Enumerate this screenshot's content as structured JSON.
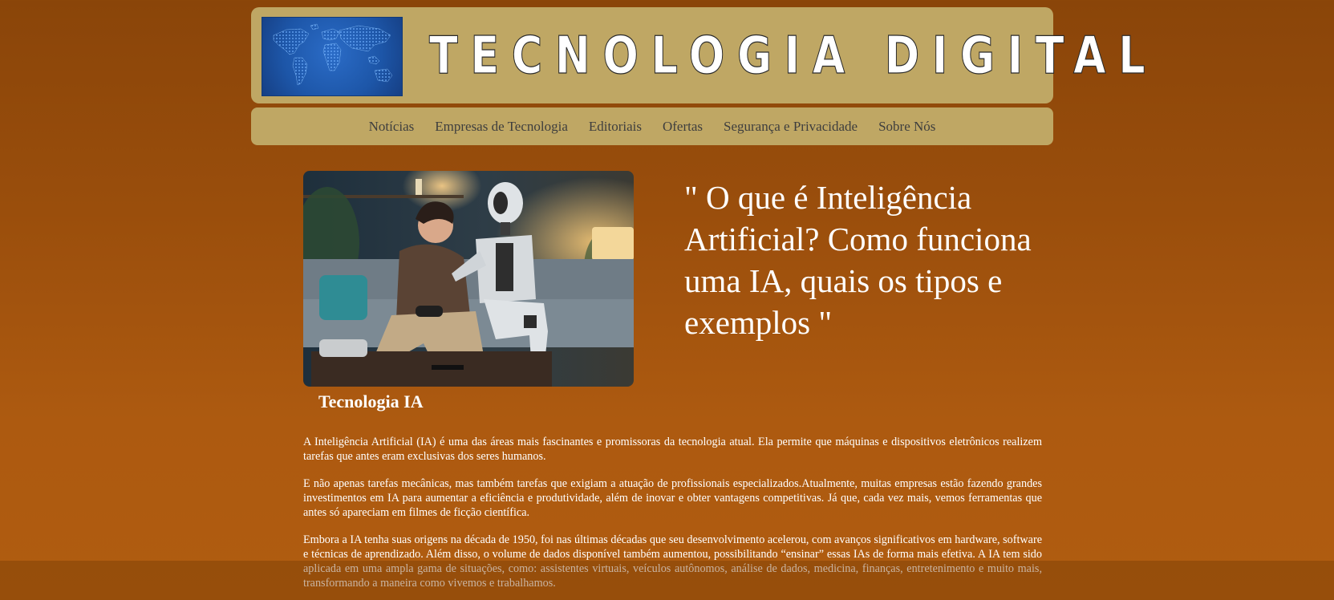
{
  "header": {
    "title": "TECNOLOGIA DIGITAL",
    "logo_icon": "world-map-icon"
  },
  "nav": {
    "items": [
      {
        "label": "Notícias"
      },
      {
        "label": "Empresas de Tecnologia"
      },
      {
        "label": "Editoriais"
      },
      {
        "label": "Ofertas"
      },
      {
        "label": "Segurança e Privacidade"
      },
      {
        "label": "Sobre Nós"
      }
    ]
  },
  "article": {
    "image_caption": "Tecnologia IA",
    "title": "\" O que é Inteligência Artificial? Como funciona uma IA, quais os tipos e exemplos \"",
    "paragraphs": [
      "A Inteligência Artificial (IA) é uma das áreas mais fascinantes e promissoras da tecnologia atual. Ela permite que máquinas e dispositivos eletrônicos realizem tarefas que antes eram exclusivas dos seres humanos.",
      "E não apenas tarefas mecânicas, mas também tarefas que exigiam a atuação de profissionais especializados.Atualmente, muitas empresas estão fazendo grandes investimentos em IA para aumentar a eficiência e produtividade, além de inovar e obter vantagens competitivas. Já que, cada vez mais, vemos ferramentas que antes só apareciam em filmes de ficção científica.",
      "Embora a IA tenha suas origens na década de 1950, foi nas últimas décadas que seu desenvolvimento acelerou, com avanços significativos em hardware, software e técnicas de aprendizado. Além disso, o volume de dados disponível também aumentou, possibilitando “ensinar” essas IAs de forma mais efetiva. A IA tem sido aplicada em uma ampla gama de situações, como: assistentes virtuais, veículos autônomos, análise de dados, medicina, finanças, entretenimento e muito mais, transformando a maneira como vivemos e trabalhamos."
    ]
  },
  "colors": {
    "header_bg": "#bfa764",
    "page_bg": "#9a4e0c",
    "text": "#ffffff",
    "nav_text": "#3e3e3e"
  }
}
